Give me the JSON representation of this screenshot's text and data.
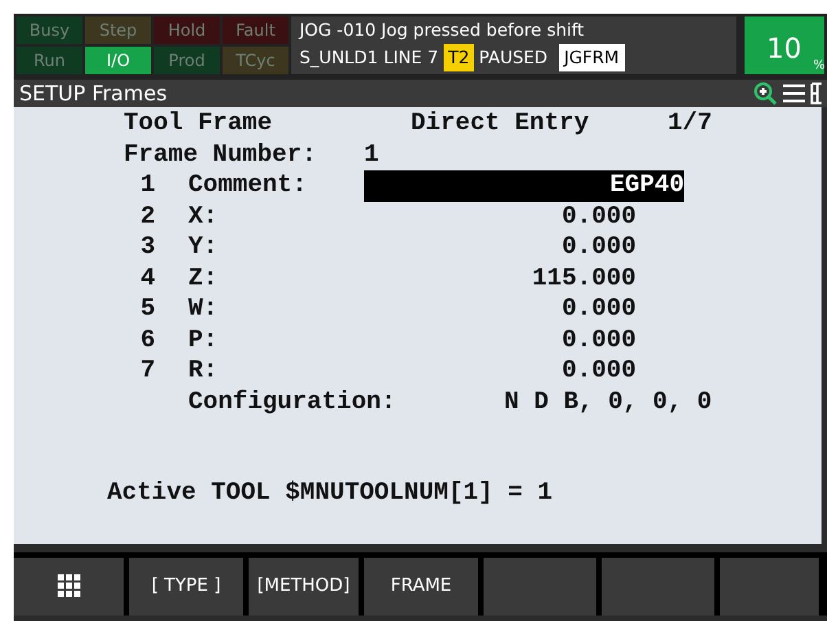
{
  "status_indicators": [
    {
      "label": "Busy",
      "on": false,
      "color": "#0f3b22"
    },
    {
      "label": "Step",
      "on": false,
      "color": "#3d3720"
    },
    {
      "label": "Hold",
      "on": false,
      "color": "#3b1012"
    },
    {
      "label": "Fault",
      "on": false,
      "color": "#3b1012"
    },
    {
      "label": "Run",
      "on": false,
      "color": "#0f3b22"
    },
    {
      "label": "I/O",
      "on": true,
      "color": "#16a34a"
    },
    {
      "label": "Prod",
      "on": false,
      "color": "#0f3b22"
    },
    {
      "label": "TCyc",
      "on": false,
      "color": "#3d3720"
    }
  ],
  "message": "JOG -010 Jog pressed before shift",
  "status_line": {
    "program": "S_UNLD1",
    "line": "LINE 7",
    "mode": "T2",
    "state": "PAUSED",
    "frame": "JGFRM"
  },
  "override": {
    "value": "10",
    "unit": "%"
  },
  "title": "SETUP Frames",
  "header": {
    "frame_type": "Tool Frame",
    "method": "Direct Entry",
    "page": "1/7",
    "frame_number_label": "Frame Number:",
    "frame_number": "1"
  },
  "rows": [
    {
      "kind": "field",
      "index": "1",
      "label": "Comment:",
      "value": "EGP40",
      "selected": true
    },
    {
      "kind": "field",
      "index": "2",
      "label": "X:",
      "value": "0.000",
      "selected": false
    },
    {
      "kind": "field",
      "index": "3",
      "label": "Y:",
      "value": "0.000",
      "selected": false
    },
    {
      "kind": "field",
      "index": "4",
      "label": "Z:",
      "value": "115.000",
      "selected": false
    },
    {
      "kind": "field",
      "index": "5",
      "label": "W:",
      "value": "0.000",
      "selected": false
    },
    {
      "kind": "field",
      "index": "6",
      "label": "P:",
      "value": "0.000",
      "selected": false
    },
    {
      "kind": "field",
      "index": "7",
      "label": "R:",
      "value": "0.000",
      "selected": false
    },
    {
      "kind": "config",
      "label": "Configuration:",
      "value": "N D B, 0, 0, 0"
    }
  ],
  "footer": "Active TOOL $MNUTOOLNUM[1] = 1",
  "softkeys": [
    {
      "kind": "grid"
    },
    {
      "kind": "label",
      "label": "[ TYPE ]"
    },
    {
      "kind": "label",
      "label": "[METHOD]"
    },
    {
      "kind": "label",
      "label": "FRAME"
    },
    {
      "kind": "blank"
    },
    {
      "kind": "blank"
    },
    {
      "kind": "blank"
    }
  ]
}
